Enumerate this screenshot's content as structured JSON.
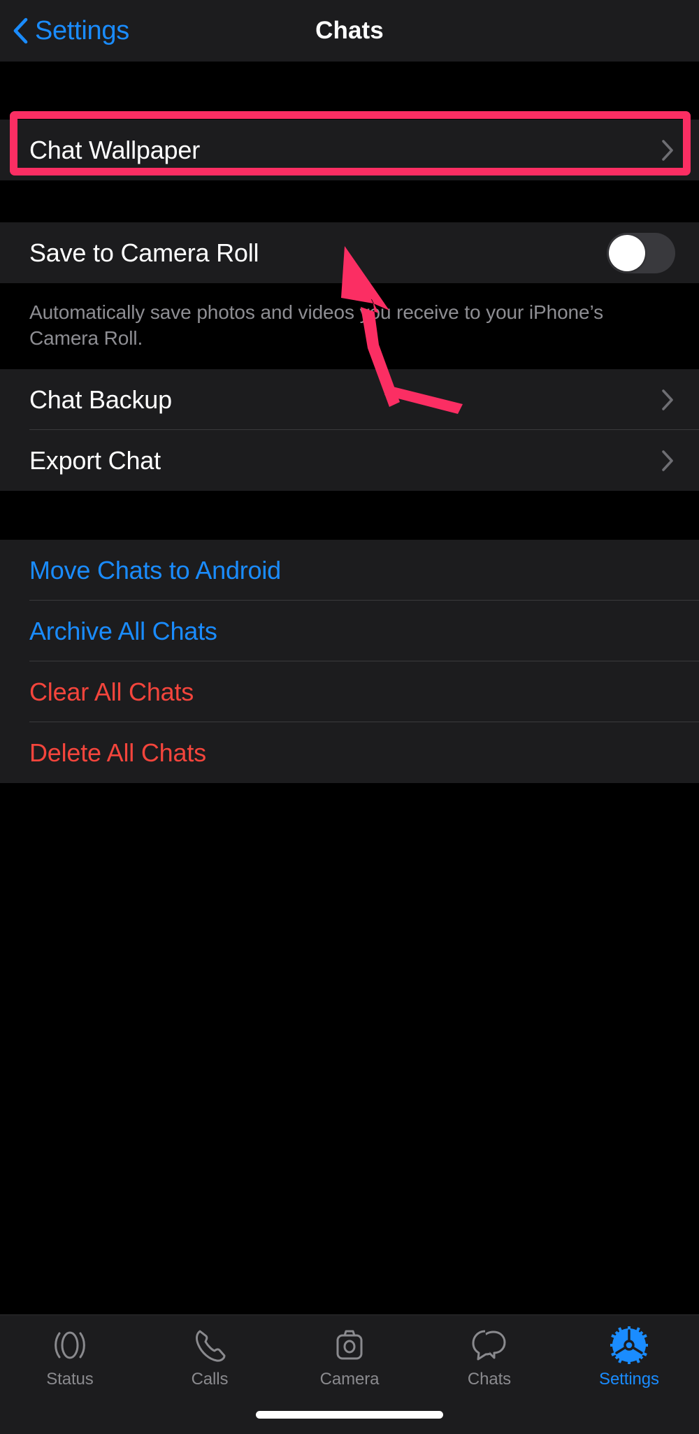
{
  "nav": {
    "back_label": "Settings",
    "back_icon": "chevron-left-icon",
    "title": "Chats"
  },
  "colors": {
    "accent_blue": "#1a8cff",
    "destructive_red": "#f4453c",
    "highlight_pink": "#fb2e63",
    "group_background": "#1c1c1e",
    "page_background": "#000000",
    "secondary_text": "#8e8e93"
  },
  "annotation": {
    "highlight_target": "Chat Wallpaper",
    "arrow_color": "#fb2e63",
    "arrow_points_to": "Chat Wallpaper"
  },
  "group_wallpaper": {
    "rows": [
      {
        "label": "Chat Wallpaper",
        "accessory": "chevron-right-icon",
        "highlighted": true
      }
    ]
  },
  "group_media": {
    "rows": [
      {
        "label": "Save to Camera Roll",
        "accessory": "toggle",
        "toggle_on": false
      }
    ],
    "footer": "Automatically save photos and videos you receive to your iPhone’s Camera Roll."
  },
  "group_backup": {
    "rows": [
      {
        "label": "Chat Backup",
        "accessory": "chevron-right-icon"
      },
      {
        "label": "Export Chat",
        "accessory": "chevron-right-icon"
      }
    ]
  },
  "group_actions": {
    "rows": [
      {
        "label": "Move Chats to Android",
        "style": "blue"
      },
      {
        "label": "Archive All Chats",
        "style": "blue"
      },
      {
        "label": "Clear All Chats",
        "style": "red"
      },
      {
        "label": "Delete All Chats",
        "style": "red"
      }
    ]
  },
  "tabbar": {
    "items": [
      {
        "label": "Status",
        "icon": "status-rings-icon",
        "active": false
      },
      {
        "label": "Calls",
        "icon": "phone-icon",
        "active": false
      },
      {
        "label": "Camera",
        "icon": "camera-icon",
        "active": false
      },
      {
        "label": "Chats",
        "icon": "chat-bubbles-icon",
        "active": false
      },
      {
        "label": "Settings",
        "icon": "gear-icon",
        "active": true
      }
    ]
  }
}
